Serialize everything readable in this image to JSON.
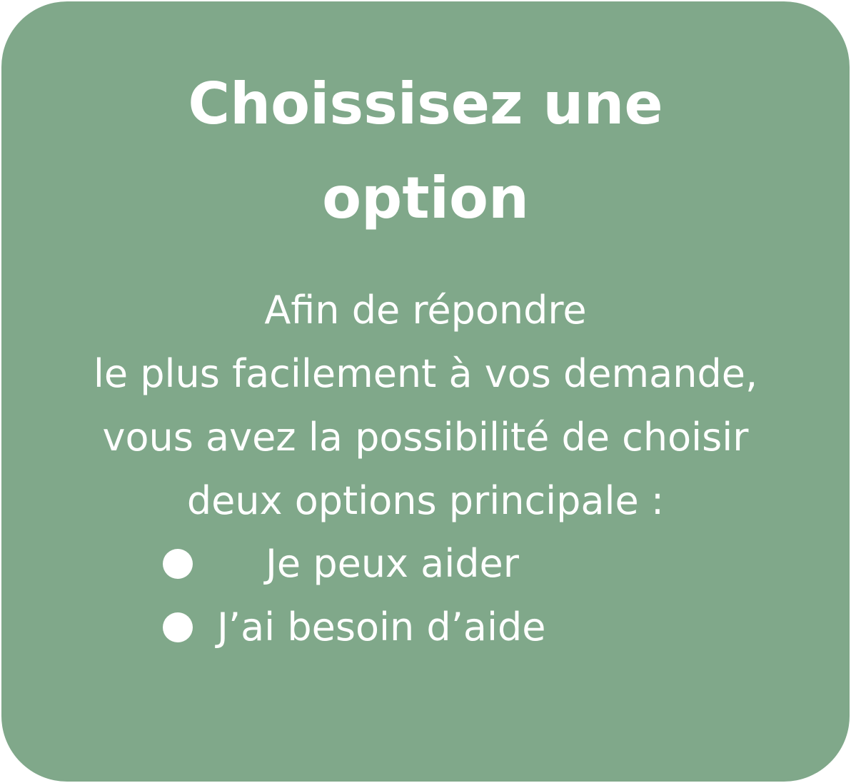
{
  "card": {
    "background_color": "#80a88a",
    "text_color": "#ffffff"
  },
  "title": {
    "line1": "Choissisez une",
    "line2": "option"
  },
  "description": {
    "lines": [
      "Afin de répondre",
      "le plus facilement à vos demande,",
      "vous avez la possibilité de choisir",
      "deux options principale :"
    ]
  },
  "options": [
    {
      "label": "Je peux aider",
      "icon": "bullet-dot-icon"
    },
    {
      "label": "J’ai besoin d’aide",
      "icon": "bullet-dot-icon"
    }
  ]
}
